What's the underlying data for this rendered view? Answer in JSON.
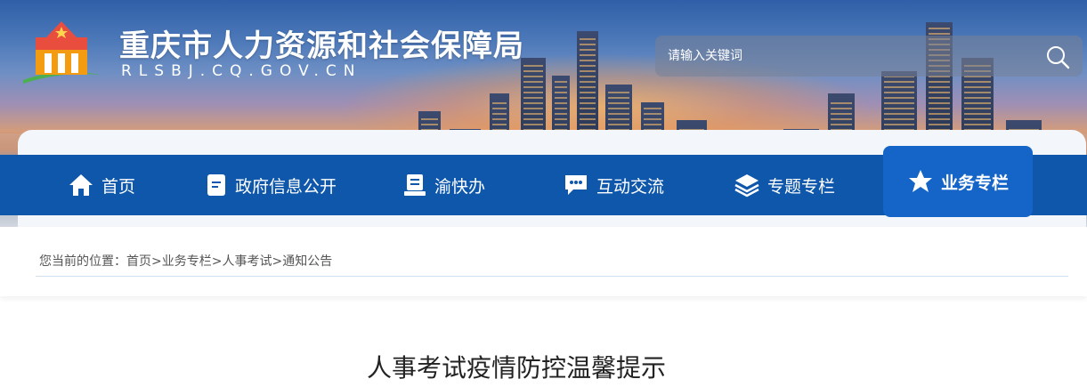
{
  "header": {
    "title": "重庆市人力资源和社会保障局",
    "domain": "RLSBJ.CQ.GOV.CN"
  },
  "search": {
    "placeholder": "请输入关键词"
  },
  "nav": {
    "items": [
      {
        "label": "首页",
        "icon": "home-icon"
      },
      {
        "label": "政府信息公开",
        "icon": "document-icon"
      },
      {
        "label": "渝快办",
        "icon": "handbook-icon"
      },
      {
        "label": "互动交流",
        "icon": "chat-icon"
      },
      {
        "label": "专题专栏",
        "icon": "layers-icon"
      },
      {
        "label": "业务专栏",
        "icon": "star-icon",
        "active": true
      }
    ]
  },
  "breadcrumb": {
    "prefix": "您当前的位置：",
    "items": [
      "首页",
      "业务专栏",
      "人事考试",
      "通知公告"
    ],
    "separator": ">"
  },
  "article": {
    "title": "人事考试疫情防控温馨提示"
  },
  "colors": {
    "nav_bg": "#0f57ab",
    "nav_active_bg": "#1565c8"
  }
}
